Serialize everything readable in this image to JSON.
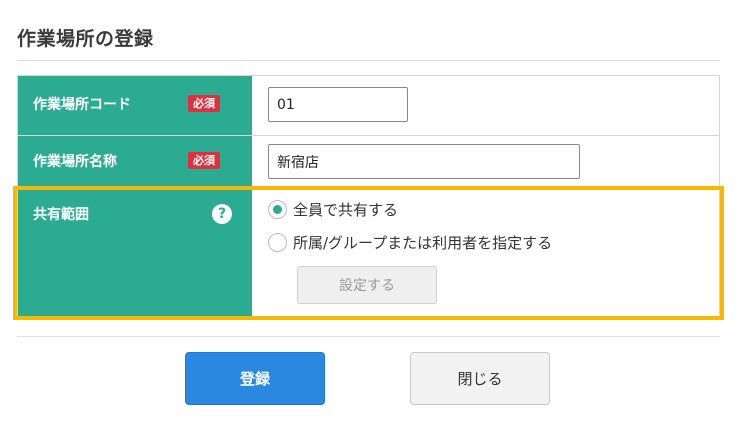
{
  "page": {
    "title": "作業場所の登録"
  },
  "form": {
    "code": {
      "label": "作業場所コード",
      "required_badge": "必須",
      "value": "01"
    },
    "name": {
      "label": "作業場所名称",
      "required_badge": "必須",
      "value": "新宿店"
    },
    "share": {
      "label": "共有範囲",
      "help_icon": "?",
      "options": [
        {
          "label": "全員で共有する",
          "selected": true
        },
        {
          "label": "所属/グループまたは利用者を指定する",
          "selected": false
        }
      ],
      "setting_button": "設定する"
    }
  },
  "actions": {
    "register": "登録",
    "close": "閉じる"
  },
  "colors": {
    "label_bg": "#2bab92",
    "required_bg": "#e0303e",
    "highlight": "#f6b800",
    "primary_button": "#2b88e0"
  }
}
